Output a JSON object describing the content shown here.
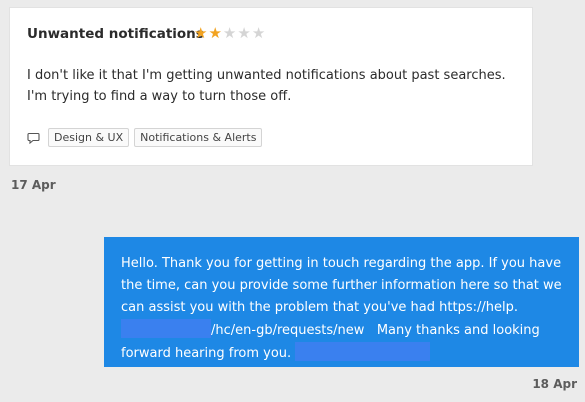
{
  "review": {
    "title": "Unwanted notifications",
    "rating": 2,
    "max_rating": 5,
    "body": "I don't like it that I'm getting unwanted notifications about past searches. I'm trying to find a way to turn those off.",
    "tags": [
      "Design & UX",
      "Notifications & Alerts"
    ],
    "tag_icon": "speech-bubble-icon",
    "date": "17 Apr"
  },
  "reply": {
    "text_part1": "Hello. Thank you for getting in touch regarding the app. If you have the time, can you provide some further information here so that we can assist you with the problem that you've had https://help.",
    "text_part2": "/hc/en-gb/requests/new",
    "text_part3": "Many thanks and looking forward hearing from you.",
    "date": "18 Apr"
  },
  "colors": {
    "star_on": "#f2a321",
    "star_off": "#d5d5d5",
    "reply_bg": "#1e88e5",
    "redaction": "#3a80ef"
  }
}
